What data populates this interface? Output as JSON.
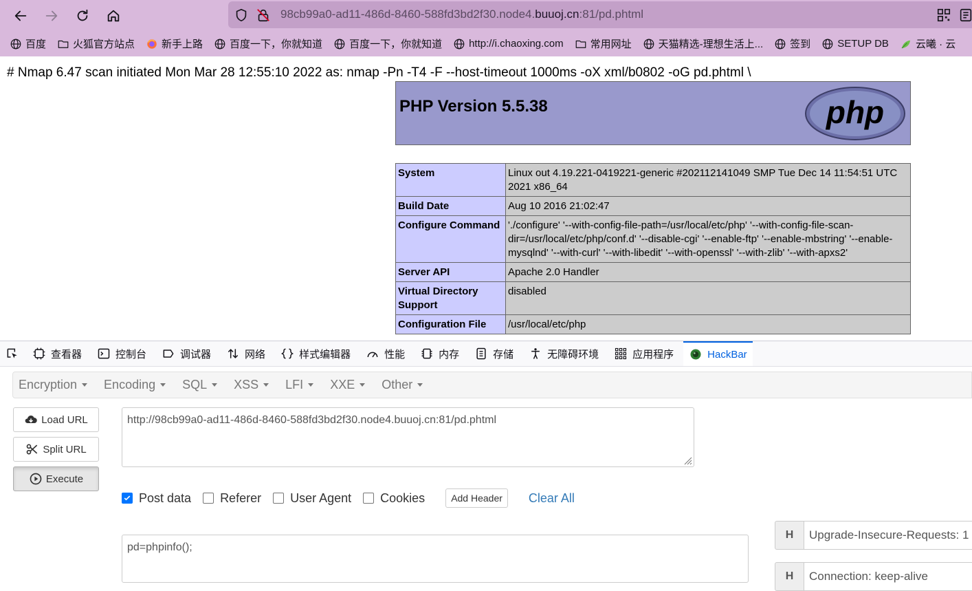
{
  "browser": {
    "url_prefix": "98cb99a0-ad11-486d-8460-588fd3bd2f30.node4.",
    "url_domain": "buuoj.cn",
    "url_suffix": ":81/pd.phtml",
    "bookmarks": [
      {
        "label": "百度",
        "icon": "globe-icon"
      },
      {
        "label": "火狐官方站点",
        "icon": "folder-icon"
      },
      {
        "label": "新手上路",
        "icon": "firefox-icon"
      },
      {
        "label": "百度一下，你就知道",
        "icon": "globe-icon"
      },
      {
        "label": "百度一下，你就知道",
        "icon": "globe-icon"
      },
      {
        "label": "http://i.chaoxing.com",
        "icon": "globe-icon"
      },
      {
        "label": "常用网址",
        "icon": "folder-icon"
      },
      {
        "label": "天猫精选-理想生活上...",
        "icon": "globe-icon"
      },
      {
        "label": "签到",
        "icon": "globe-icon"
      },
      {
        "label": "SETUP DB",
        "icon": "globe-icon"
      },
      {
        "label": "云曦 · 云",
        "icon": "leaf-icon"
      }
    ]
  },
  "page": {
    "nmap_line": "# Nmap 6.47 scan initiated Mon Mar 28 12:55:10 2022 as: nmap -Pn -T4 -F --host-timeout 1000ms -oX xml/b0802 -oG pd.phtml \\",
    "php_version_title": "PHP Version 5.5.38",
    "php_logo_text": "php",
    "rows": [
      {
        "key": "System",
        "value": "Linux out 4.19.221-0419221-generic #202112141049 SMP Tue Dec 14 11:54:51 UTC 2021 x86_64"
      },
      {
        "key": "Build Date",
        "value": "Aug 10 2016 21:02:47"
      },
      {
        "key": "Configure Command",
        "value": "'./configure' '--with-config-file-path=/usr/local/etc/php' '--with-config-file-scan-dir=/usr/local/etc/php/conf.d' '--disable-cgi' '--enable-ftp' '--enable-mbstring' '--enable-mysqlnd' '--with-curl' '--with-libedit' '--with-openssl' '--with-zlib' '--with-apxs2'"
      },
      {
        "key": "Server API",
        "value": "Apache 2.0 Handler"
      },
      {
        "key": "Virtual Directory Support",
        "value": "disabled"
      },
      {
        "key": "Configuration File",
        "value": "/usr/local/etc/php"
      }
    ]
  },
  "devtools": {
    "tabs": [
      {
        "label": "查看器",
        "icon": "inspector-icon"
      },
      {
        "label": "控制台",
        "icon": "console-icon"
      },
      {
        "label": "调试器",
        "icon": "debugger-icon"
      },
      {
        "label": "网络",
        "icon": "network-icon"
      },
      {
        "label": "样式编辑器",
        "icon": "braces-icon"
      },
      {
        "label": "性能",
        "icon": "gauge-icon"
      },
      {
        "label": "内存",
        "icon": "memory-icon"
      },
      {
        "label": "存储",
        "icon": "storage-icon"
      },
      {
        "label": "无障碍环境",
        "icon": "accessibility-icon"
      },
      {
        "label": "应用程序",
        "icon": "grid-icon"
      },
      {
        "label": "HackBar",
        "icon": "hackbar-icon"
      }
    ],
    "active_tab": "HackBar"
  },
  "hackbar": {
    "menu": [
      "Encryption",
      "Encoding",
      "SQL",
      "XSS",
      "LFI",
      "XXE",
      "Other"
    ],
    "load_url": "Load URL",
    "split_url": "Split URL",
    "execute": "Execute",
    "url_value": "http://98cb99a0-ad11-486d-8460-588fd3bd2f30.node4.buuoj.cn:81/pd.phtml",
    "options": {
      "post_data": "Post data",
      "referer": "Referer",
      "user_agent": "User Agent",
      "cookies": "Cookies"
    },
    "post_data_checked": true,
    "add_header": "Add Header",
    "clear_all": "Clear All",
    "post_value": "pd=phpinfo();",
    "headers": [
      {
        "h": "H",
        "value": "Upgrade-Insecure-Requests: 1"
      },
      {
        "h": "H",
        "value": "Connection: keep-alive"
      }
    ]
  },
  "colors": {
    "browser_chrome": "#d9b9dc",
    "urlbar": "#c3a0c8",
    "php_header": "#9999cc",
    "php_key_cell": "#ccccff",
    "php_value_cell": "#cccccc",
    "devtools_active": "#0061e0",
    "link": "#337ab7"
  }
}
